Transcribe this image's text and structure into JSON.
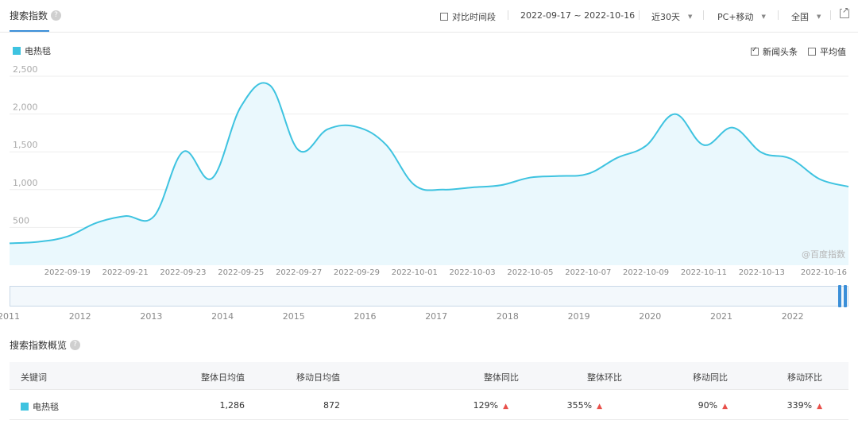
{
  "header": {
    "title": "搜索指数",
    "compare_label": "对比时间段",
    "date_range": "2022-09-17 ~ 2022-10-16",
    "period": "近30天",
    "device": "PC+移动",
    "region": "全国"
  },
  "legend": {
    "keyword": "电热毯"
  },
  "options": {
    "news_label": "新闻头条",
    "news_checked": true,
    "avg_label": "平均值",
    "avg_checked": false
  },
  "watermark": "@百度指数",
  "colors": {
    "line": "#3ec3e0",
    "fill": "#eaf8fd",
    "accent": "#3b8fd8",
    "up": "#e8504a"
  },
  "chart_data": {
    "type": "area",
    "title": "",
    "xlabel": "",
    "ylabel": "",
    "ylim": [
      0,
      2500
    ],
    "y_ticks": [
      "500",
      "1,000",
      "1,500",
      "2,000",
      "2,500"
    ],
    "x_tick_labels": [
      "2022-09-19",
      "2022-09-21",
      "2022-09-23",
      "2022-09-25",
      "2022-09-27",
      "2022-09-29",
      "2022-10-01",
      "2022-10-03",
      "2022-10-05",
      "2022-10-07",
      "2022-10-09",
      "2022-10-11",
      "2022-10-13",
      "2022-10-16"
    ],
    "x": [
      "2022-09-17",
      "2022-09-18",
      "2022-09-19",
      "2022-09-20",
      "2022-09-21",
      "2022-09-22",
      "2022-09-23",
      "2022-09-24",
      "2022-09-25",
      "2022-09-26",
      "2022-09-27",
      "2022-09-28",
      "2022-09-29",
      "2022-09-30",
      "2022-10-01",
      "2022-10-02",
      "2022-10-03",
      "2022-10-04",
      "2022-10-05",
      "2022-10-06",
      "2022-10-07",
      "2022-10-08",
      "2022-10-09",
      "2022-10-10",
      "2022-10-11",
      "2022-10-12",
      "2022-10-13",
      "2022-10-14",
      "2022-10-15",
      "2022-10-16"
    ],
    "series": [
      {
        "values": [
          290,
          310,
          380,
          560,
          650,
          650,
          1500,
          1150,
          2100,
          2380,
          1520,
          1800,
          1830,
          1600,
          1060,
          1000,
          1030,
          1060,
          1160,
          1180,
          1210,
          1420,
          1580,
          2000,
          1590,
          1820,
          1490,
          1410,
          1140,
          1040
        ]
      }
    ],
    "grid": true
  },
  "brush": {
    "years": [
      "2011",
      "2012",
      "2013",
      "2014",
      "2015",
      "2016",
      "2017",
      "2018",
      "2019",
      "2020",
      "2021",
      "2022"
    ]
  },
  "overview": {
    "title": "搜索指数概览",
    "headers": {
      "keyword": "关键词",
      "overall_avg": "整体日均值",
      "mobile_avg": "移动日均值",
      "overall_yoy": "整体同比",
      "overall_mom": "整体环比",
      "mobile_yoy": "移动同比",
      "mobile_mom": "移动环比"
    },
    "row": {
      "keyword": "电热毯",
      "overall_avg": "1,286",
      "mobile_avg": "872",
      "overall_yoy": "129%",
      "overall_mom": "355%",
      "mobile_yoy": "90%",
      "mobile_mom": "339%"
    }
  }
}
